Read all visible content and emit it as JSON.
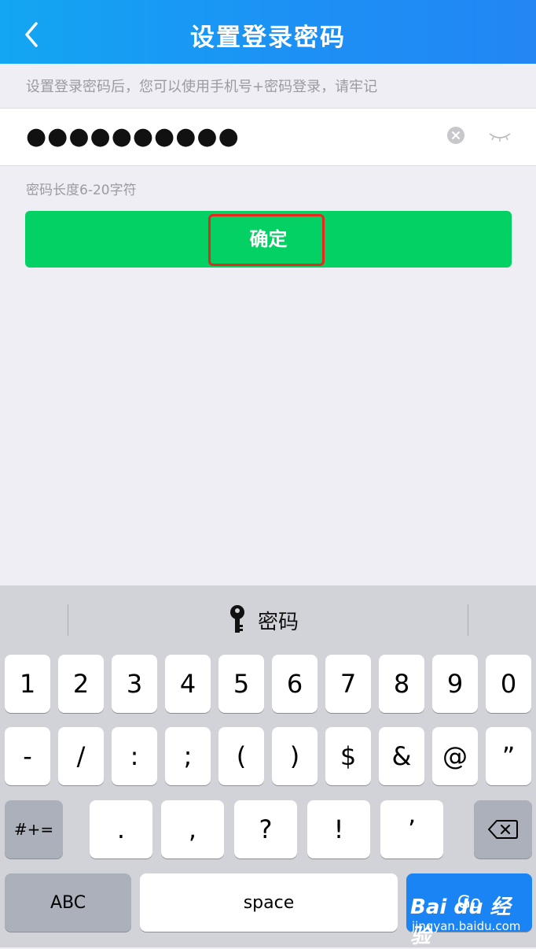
{
  "header": {
    "title": "设置登录密码",
    "back_icon": "chevron-left-icon"
  },
  "hint_top": "设置登录密码后，您可以使用手机号+密码登录，请牢记",
  "password": {
    "value": "●●●●●●●●●●",
    "clear_icon": "clear-circle-icon",
    "toggle_icon": "eye-closed-icon"
  },
  "hint_length": "密码长度6-20字符",
  "confirm_label": "确定",
  "keyboard": {
    "suggestion": "密码",
    "suggestion_icon": "key-icon",
    "row1": [
      "1",
      "2",
      "3",
      "4",
      "5",
      "6",
      "7",
      "8",
      "9",
      "0"
    ],
    "row2": [
      "-",
      "/",
      ":",
      ";",
      "(",
      ")",
      "$",
      "&",
      "@",
      "”"
    ],
    "row3": [
      ".",
      ",",
      "?",
      "!",
      "’"
    ],
    "symbols_label": "#+=",
    "abc_label": "ABC",
    "space_label": "space",
    "go_label": "Go",
    "backspace_icon": "backspace-icon"
  },
  "watermark": {
    "logo": "Bai du 经验",
    "url": "jingyan.baidu.com"
  }
}
